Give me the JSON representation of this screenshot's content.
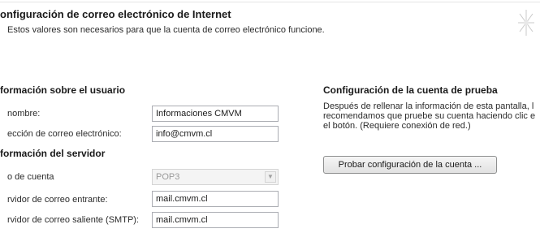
{
  "header": {
    "title": "onfiguración de correo electrónico de Internet",
    "subtitle": "Estos valores son necesarios para que la cuenta de correo electrónico funcione."
  },
  "user_info": {
    "heading": "formación sobre el usuario",
    "name_label": "nombre:",
    "name_value": "Informaciones CMVM",
    "email_label": "ección de correo electrónico:",
    "email_value": "info@cmvm.cl"
  },
  "server_info": {
    "heading": "formación del servidor",
    "account_type_label": "o de cuenta",
    "account_type_value": "POP3",
    "incoming_label": "rvidor de correo entrante:",
    "incoming_value": "mail.cmvm.cl",
    "outgoing_label": "rvidor de correo saliente (SMTP):",
    "outgoing_value": "mail.cmvm.cl"
  },
  "test_settings": {
    "heading": "Configuración de la cuenta de prueba",
    "line1": "Después de rellenar la información de esta pantalla, l",
    "line2": "recomendamos que pruebe su cuenta haciendo clic e",
    "line3": "el botón. (Requiere conexión de red.)",
    "button_label": "Probar configuración de la cuenta ..."
  },
  "icons": {
    "header": "sparkle-icon",
    "select_arrow": "chevron-down-icon"
  },
  "colors": {
    "input_border": "#abadb3",
    "disabled_text": "#9a9a9a"
  }
}
